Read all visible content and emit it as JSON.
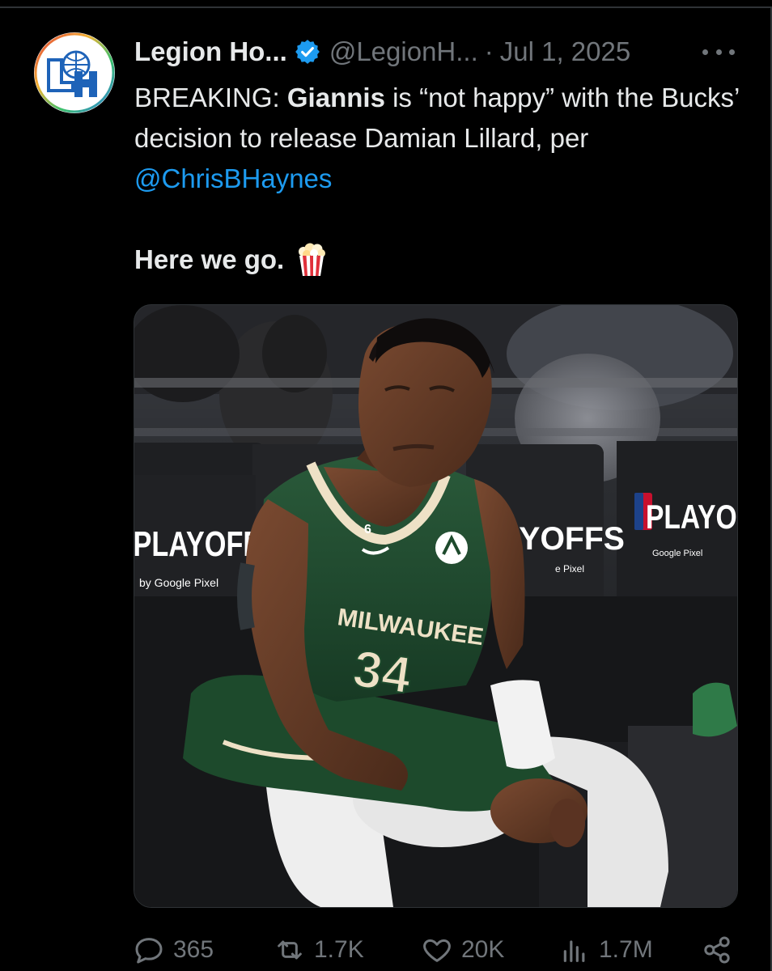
{
  "post": {
    "author": {
      "display_name": "Legion Ho...",
      "handle": "@LegionH...",
      "avatar_text": "LH",
      "verified": true
    },
    "separator": "·",
    "date": "Jul 1, 2025",
    "text": {
      "prefix": "BREAKING: ",
      "bold_name": "Giannis",
      "middle": " is “not happy” with the Bucks’ decision to release Damian Lillard, per ",
      "mention": "@ChrisBHaynes",
      "closing": "Here we go."
    },
    "closing_emoji": "popcorn",
    "media": {
      "description": "photo",
      "signage": {
        "left": "PLAYOFFS",
        "left_sub": "by Google Pixel",
        "center": "YOFFS",
        "center_sub": "e Pixel",
        "right": "PLAYOFF",
        "right_sub": "Google Pixel"
      },
      "jersey": {
        "team": "MILWAUKEE",
        "number": "34",
        "patch": "6"
      }
    },
    "metrics": {
      "replies": "365",
      "reposts": "1.7K",
      "likes": "20K",
      "views": "1.7M"
    }
  },
  "colors": {
    "background": "#000000",
    "text_primary": "#e7e9ea",
    "text_secondary": "#71767b",
    "accent": "#1d9bf0",
    "verified": "#1d9bf0",
    "jersey_green": "#1f4a2e",
    "jersey_cream": "#eee1c6"
  }
}
